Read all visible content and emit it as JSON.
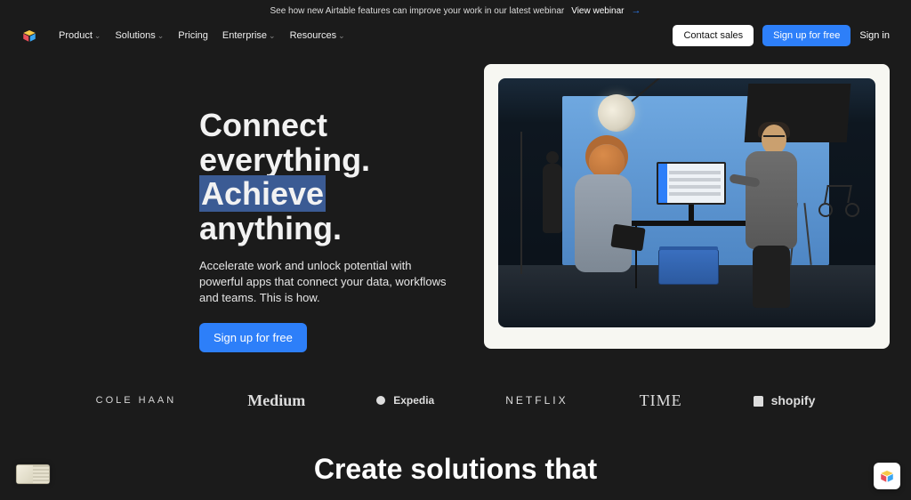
{
  "announce": {
    "text": "See how new Airtable features can improve your work in our latest webinar",
    "link_label": "View webinar"
  },
  "nav": {
    "items": [
      {
        "label": "Product",
        "has_children": true
      },
      {
        "label": "Solutions",
        "has_children": true
      },
      {
        "label": "Pricing",
        "has_children": false
      },
      {
        "label": "Enterprise",
        "has_children": true
      },
      {
        "label": "Resources",
        "has_children": true
      }
    ],
    "contact_label": "Contact sales",
    "signup_label": "Sign up for free",
    "signin_label": "Sign in"
  },
  "hero": {
    "title_line1": "Connect",
    "title_line2": "everything.",
    "title_highlight": "Achieve",
    "title_line4": "anything.",
    "subtitle": "Accelerate work and unlock potential with powerful apps that connect your data, workflows and teams. This is how.",
    "cta_label": "Sign up for free"
  },
  "logos": [
    {
      "name": "colehaan",
      "label": "COLE HAAN"
    },
    {
      "name": "medium",
      "label": "Medium"
    },
    {
      "name": "expedia",
      "label": "Expedia"
    },
    {
      "name": "netflix",
      "label": "NETFLIX"
    },
    {
      "name": "time",
      "label": "TIME"
    },
    {
      "name": "shopify",
      "label": "shopify"
    }
  ],
  "second_heading": "Create solutions that",
  "colors": {
    "accent": "#2d7ff9",
    "bg": "#1b1b1b",
    "highlight_bg": "#3b5b94"
  }
}
